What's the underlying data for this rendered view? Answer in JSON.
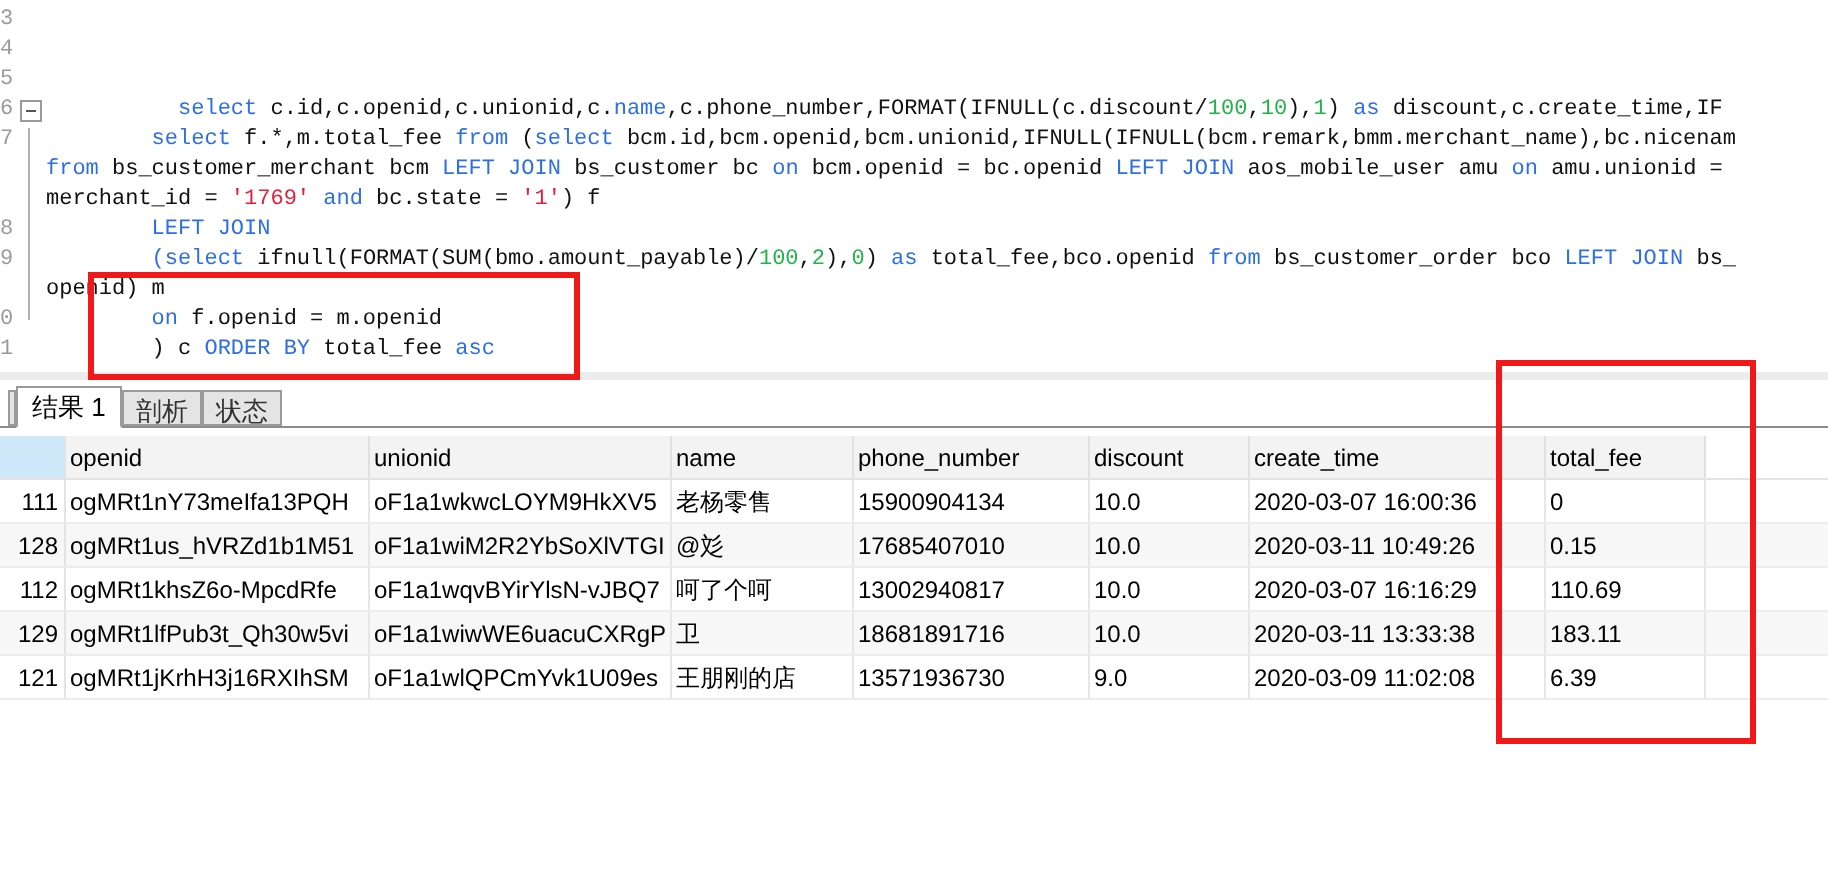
{
  "editor": {
    "lines": [
      {
        "number": "3"
      },
      {
        "number": "4"
      },
      {
        "number": "5"
      },
      {
        "number": "6",
        "fold": true,
        "tokens": [
          {
            "kind": "keyword",
            "text": "          select"
          },
          {
            "kind": "plain",
            "text": " c.id,c.openid,c.unionid,c."
          },
          {
            "kind": "keyword",
            "text": "name"
          },
          {
            "kind": "plain",
            "text": ",c.phone_number,FORMAT(IFNULL(c.discount/"
          },
          {
            "kind": "number",
            "text": "100"
          },
          {
            "kind": "plain",
            "text": ","
          },
          {
            "kind": "number",
            "text": "10"
          },
          {
            "kind": "plain",
            "text": "),"
          },
          {
            "kind": "number",
            "text": "1"
          },
          {
            "kind": "plain",
            "text": ") "
          },
          {
            "kind": "keyword",
            "text": "as"
          },
          {
            "kind": "plain",
            "text": " discount,c.create_time,IF"
          }
        ]
      },
      {
        "number": "7",
        "tokens": [
          {
            "kind": "keyword",
            "text": "        select"
          },
          {
            "kind": "plain",
            "text": " f.*,m.total_fee "
          },
          {
            "kind": "keyword",
            "text": "from"
          },
          {
            "kind": "plain",
            "text": " ("
          },
          {
            "kind": "keyword",
            "text": "select"
          },
          {
            "kind": "plain",
            "text": " bcm.id,bcm.openid,bcm.unionid,IFNULL(IFNULL(bcm.remark,bmm.merchant_name),bc.nicenam"
          }
        ]
      },
      {
        "tokens": [
          {
            "kind": "keyword",
            "text": "from"
          },
          {
            "kind": "plain",
            "text": " bs_customer_merchant bcm "
          },
          {
            "kind": "keyword",
            "text": "LEFT JOIN"
          },
          {
            "kind": "plain",
            "text": " bs_customer bc "
          },
          {
            "kind": "keyword",
            "text": "on"
          },
          {
            "kind": "plain",
            "text": " bcm.openid = bc.openid "
          },
          {
            "kind": "keyword",
            "text": "LEFT JOIN"
          },
          {
            "kind": "plain",
            "text": " aos_mobile_user amu "
          },
          {
            "kind": "keyword",
            "text": "on"
          },
          {
            "kind": "plain",
            "text": " amu.unionid ="
          }
        ]
      },
      {
        "tokens": [
          {
            "kind": "plain",
            "text": "merchant_id = "
          },
          {
            "kind": "string",
            "text": "'1769'"
          },
          {
            "kind": "keyword",
            "text": " and"
          },
          {
            "kind": "plain",
            "text": " bc.state = "
          },
          {
            "kind": "string",
            "text": "'1'"
          },
          {
            "kind": "plain",
            "text": ") f"
          }
        ]
      },
      {
        "number": "8",
        "tokens": [
          {
            "kind": "keyword",
            "text": "        LEFT JOIN"
          }
        ]
      },
      {
        "number": "9",
        "tokens": [
          {
            "kind": "keyword",
            "text": "        (select"
          },
          {
            "kind": "plain",
            "text": " ifnull(FORMAT(SUM(bmo.amount_payable)/"
          },
          {
            "kind": "number",
            "text": "100"
          },
          {
            "kind": "plain",
            "text": ","
          },
          {
            "kind": "number",
            "text": "2"
          },
          {
            "kind": "plain",
            "text": "),"
          },
          {
            "kind": "number",
            "text": "0"
          },
          {
            "kind": "plain",
            "text": ") "
          },
          {
            "kind": "keyword",
            "text": "as"
          },
          {
            "kind": "plain",
            "text": " total_fee,bco.openid "
          },
          {
            "kind": "keyword",
            "text": "from"
          },
          {
            "kind": "plain",
            "text": " bs_customer_order bco "
          },
          {
            "kind": "keyword",
            "text": "LEFT JOIN"
          },
          {
            "kind": "plain",
            "text": " bs_"
          }
        ]
      },
      {
        "tokens": [
          {
            "kind": "plain",
            "text": "openid) m"
          }
        ]
      },
      {
        "number": "0",
        "tokens": [
          {
            "kind": "keyword",
            "text": "        on"
          },
          {
            "kind": "plain",
            "text": " f.openid = m.openid"
          }
        ]
      },
      {
        "number": "1",
        "tokens": [
          {
            "kind": "plain",
            "text": "        ) c "
          },
          {
            "kind": "keyword",
            "text": "ORDER BY"
          },
          {
            "kind": "plain",
            "text": " total_fee "
          },
          {
            "kind": "keyword",
            "text": "asc"
          }
        ]
      }
    ]
  },
  "tabs": [
    {
      "label": "结果 1",
      "selected": true
    },
    {
      "label": "剖析",
      "selected": false
    },
    {
      "label": "状态",
      "selected": false
    }
  ],
  "table": {
    "columns": [
      "openid",
      "unionid",
      "name",
      "phone_number",
      "discount",
      "create_time",
      "total_fee"
    ],
    "rows": [
      {
        "number": "111",
        "cells": [
          "ogMRt1nY73meIfa13PQH",
          "oF1a1wkwcLOYM9HkXV5",
          "老杨零售",
          "15900904134",
          "10.0",
          "2020-03-07 16:00:36",
          "0"
        ]
      },
      {
        "number": "128",
        "cells": [
          "ogMRt1us_hVRZd1b1M51",
          "oF1a1wiM2R2YbSoXlVTGI",
          "@彣",
          "17685407010",
          "10.0",
          "2020-03-11 10:49:26",
          "0.15"
        ]
      },
      {
        "number": "112",
        "cells": [
          "ogMRt1khsZ6o-MpcdRfe",
          "oF1a1wqvBYirYlsN-vJBQ7",
          "呵了个呵",
          "13002940817",
          "10.0",
          "2020-03-07 16:16:29",
          "110.69"
        ]
      },
      {
        "number": "129",
        "cells": [
          "ogMRt1lfPub3t_Qh30w5vi",
          "oF1a1wiwWE6uacuCXRgP",
          "卫",
          "18681891716",
          "10.0",
          "2020-03-11 13:33:38",
          "183.11"
        ]
      },
      {
        "number": "121",
        "cells": [
          "ogMRt1jKrhH3j16RXIhSM",
          "oF1a1wlQPCmYvk1U09es",
          "王朋刚的店",
          "13571936730",
          "9.0",
          "2020-03-09 11:02:08",
          "6.39"
        ]
      }
    ]
  }
}
